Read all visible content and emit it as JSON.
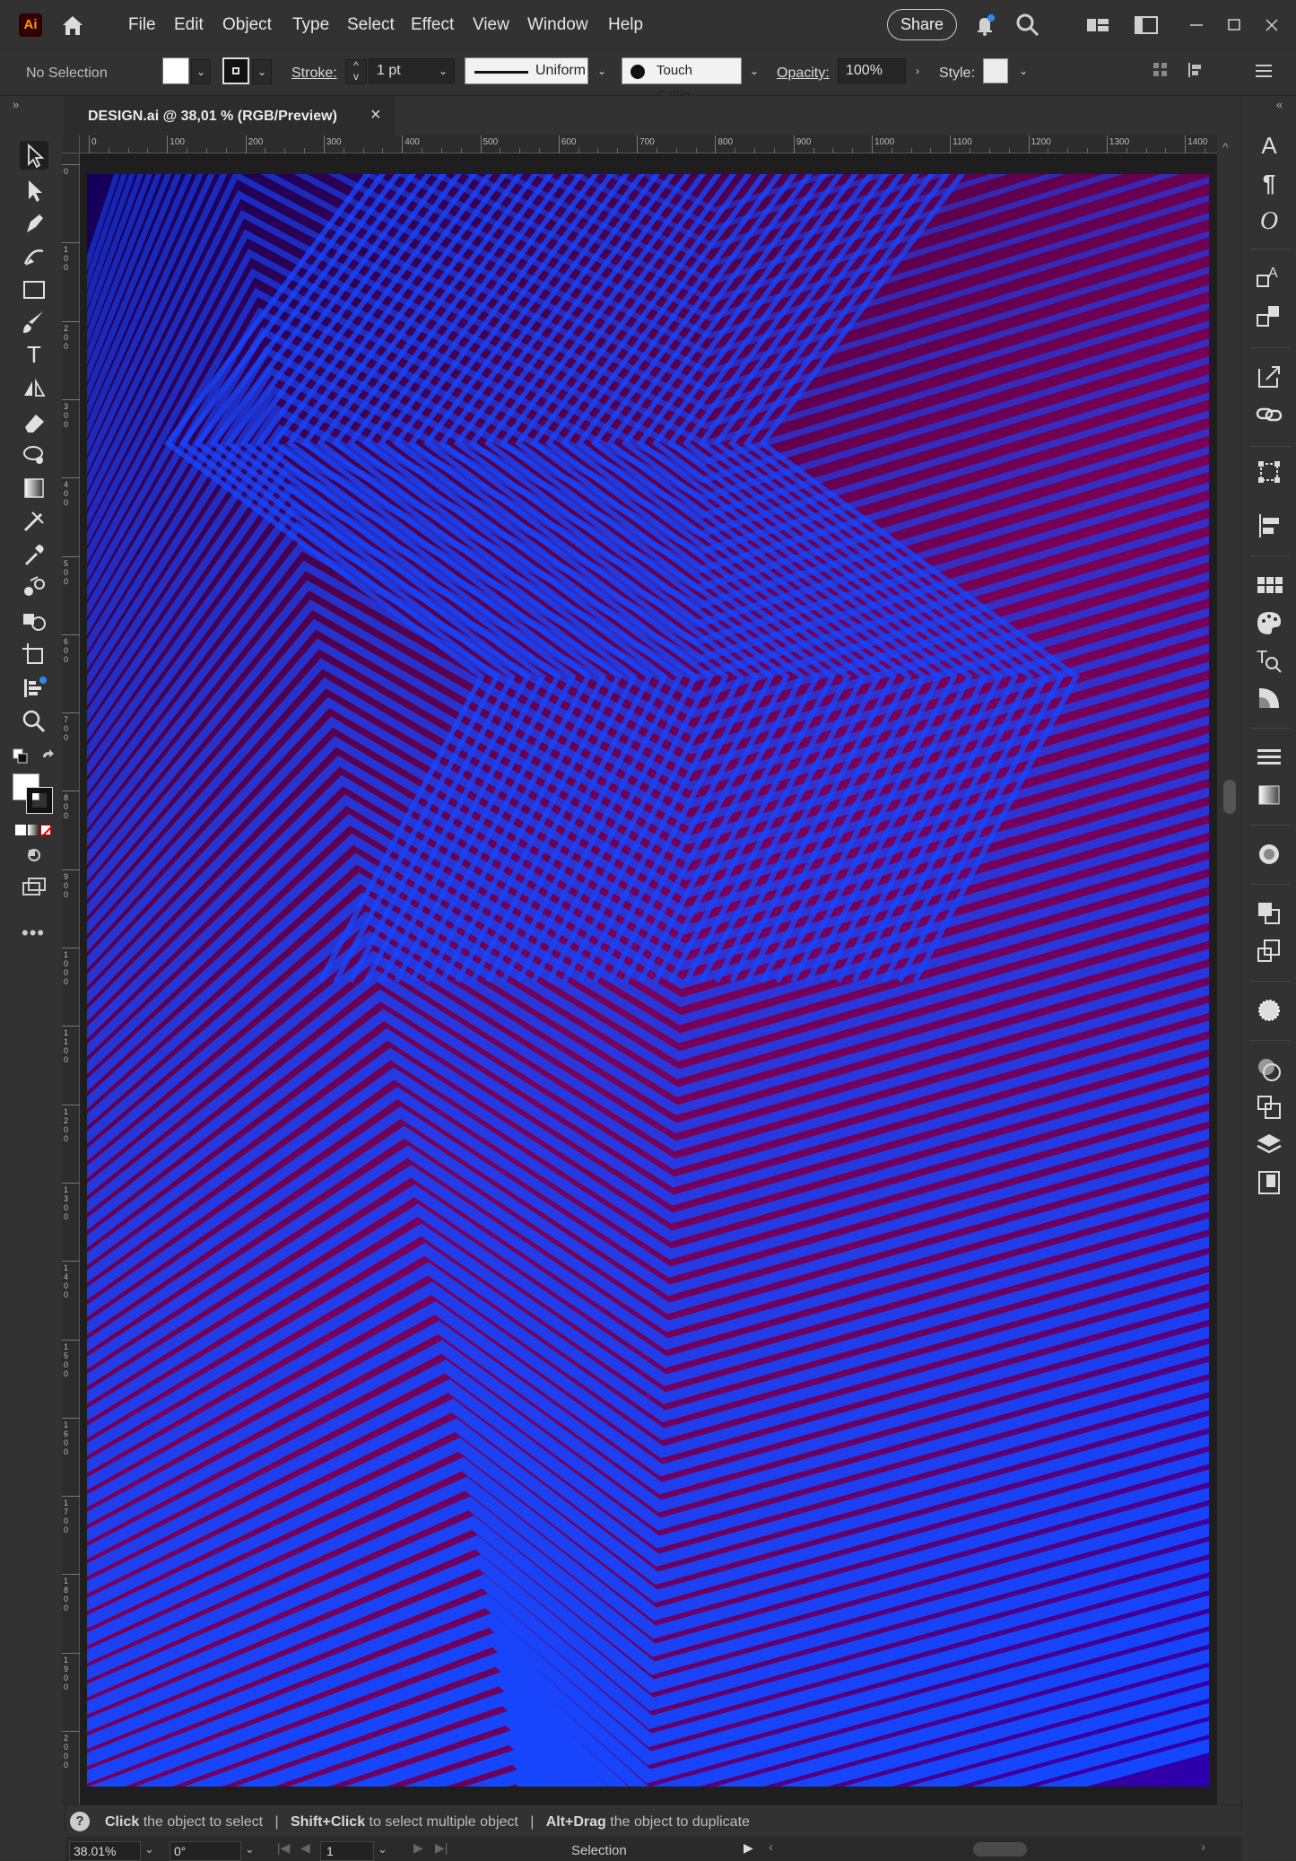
{
  "app": {
    "logo": "Ai"
  },
  "menu": [
    "File",
    "Edit",
    "Object",
    "Type",
    "Select",
    "Effect",
    "View",
    "Window",
    "Help"
  ],
  "header": {
    "share_label": "Share"
  },
  "control": {
    "selection": "No Selection",
    "stroke_label": "Stroke:",
    "stroke_weight": "1 pt",
    "profile": "Uniform",
    "brush": "Touch Callig...",
    "opacity_label": "Opacity:",
    "opacity_value": "100%",
    "style_label": "Style:"
  },
  "document": {
    "tab_title": "DESIGN.ai @ 38,01 % (RGB/Preview)",
    "close": "×"
  },
  "ruler": {
    "h_ticks": [
      "0",
      "100",
      "200",
      "300",
      "400",
      "500",
      "600",
      "700",
      "800",
      "900",
      "1000",
      "1100",
      "1200",
      "1300",
      "1400"
    ],
    "v_ticks": [
      "0",
      "100",
      "200",
      "300",
      "400",
      "500",
      "600",
      "700",
      "800",
      "900",
      "1000",
      "1100",
      "1200",
      "1300",
      "1400",
      "1500",
      "1600",
      "1700",
      "1800",
      "1900",
      "2000"
    ]
  },
  "status": {
    "help_icon": "?",
    "part1_bold": "Click",
    "part1": " the object to select",
    "sep1": "|",
    "part2_bold": "Shift+Click",
    "part2": " to select multiple object",
    "sep2": "|",
    "part3_bold": "Alt+Drag",
    "part3": " the object to duplicate"
  },
  "bottom": {
    "zoom": "38.01%",
    "rotation": "0°",
    "artboard_num": "1",
    "tool_name": "Selection"
  },
  "colors": {
    "accent_blue": "#1546ff",
    "stripe_red": "#8a0c55",
    "bg_dark": "#323232"
  }
}
